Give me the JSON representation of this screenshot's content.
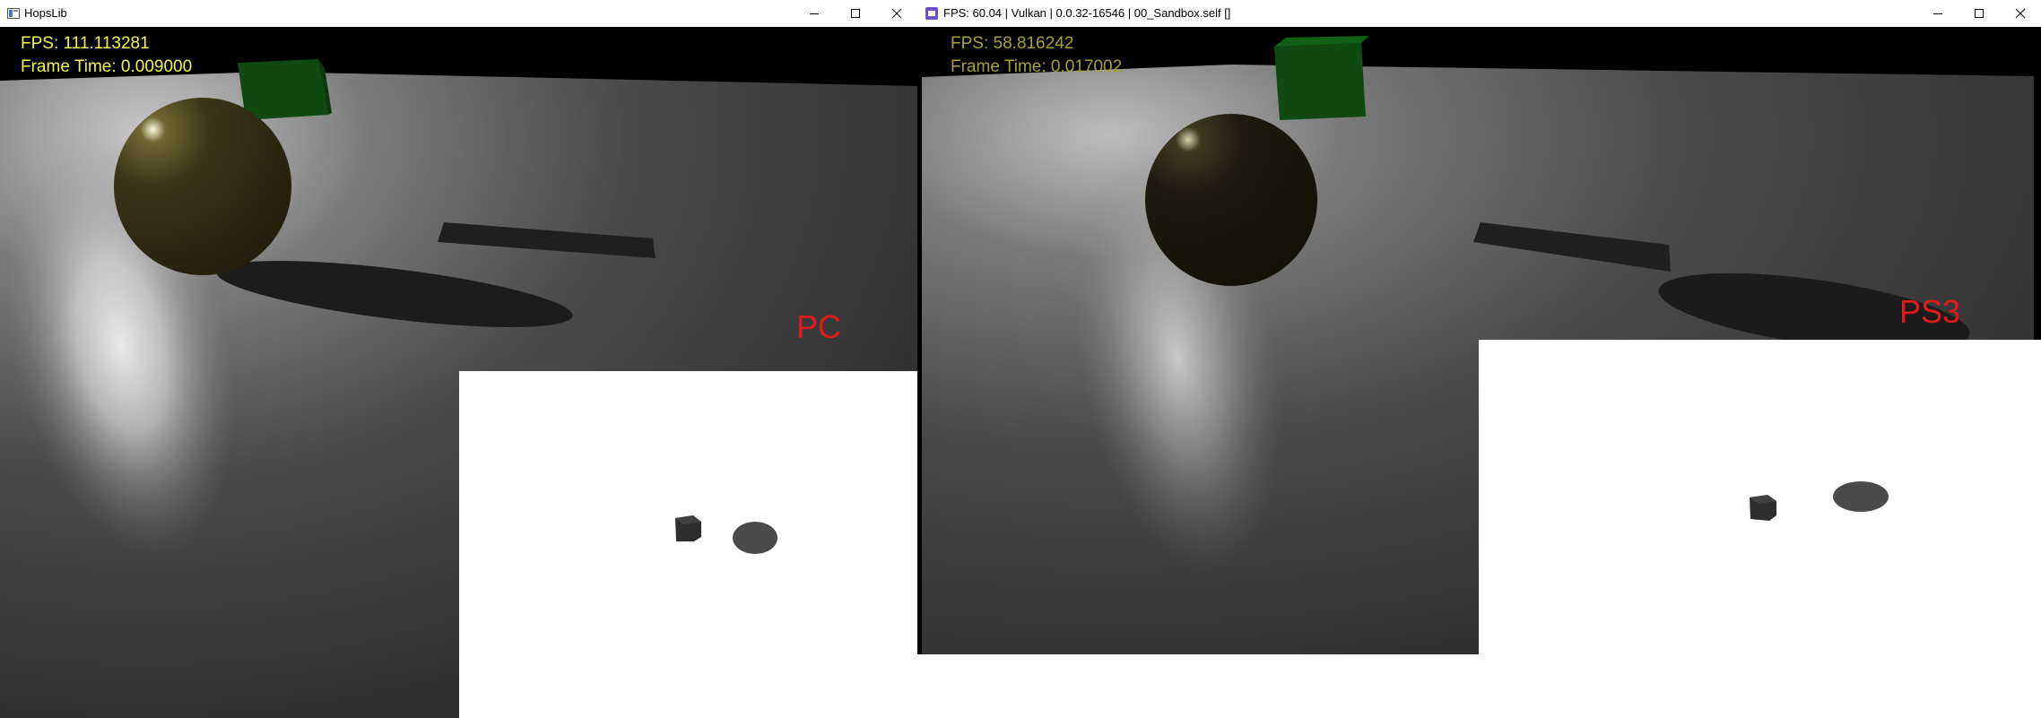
{
  "left_window": {
    "title": "HopsLib",
    "app_icon": "hopslib-app-icon",
    "controls": [
      "minimize-icon",
      "maximize-icon",
      "close-icon"
    ],
    "hud": {
      "fps": "FPS: 111.113281",
      "frame_time": "Frame Time: 0.009000",
      "color": "#f5f542"
    },
    "platform_label": "PC"
  },
  "right_window": {
    "title": "FPS: 60.04 | Vulkan | 0.0.32-16546 | 00_Sandbox.self []",
    "app_icon": "rpcs3-app-icon",
    "controls": [
      "minimize-icon",
      "maximize-icon",
      "close-icon"
    ],
    "hud": {
      "fps": "FPS: 58.816242",
      "frame_time": "Frame Time: 0.017002",
      "color": "#a8a22a"
    },
    "platform_label": "PS3"
  },
  "colors": {
    "label_red": "#e11a1a",
    "sphere": "#2e2b12",
    "cube": "#0f4a12",
    "shadow": "#1c1c1c",
    "floor": "#3c3c3c"
  }
}
